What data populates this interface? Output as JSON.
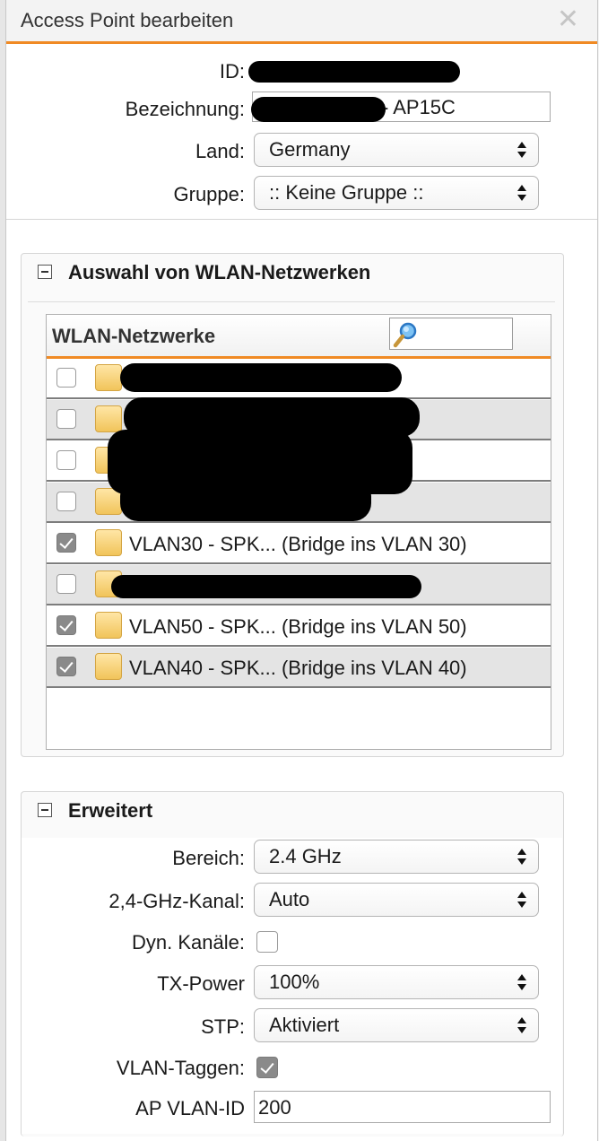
{
  "dialog": {
    "title": "Access Point bearbeiten",
    "close_icon": "close-icon"
  },
  "general": {
    "id_label": "ID:",
    "name_label": "Bezeichnung:",
    "name_value": "- AP15C",
    "country_label": "Land:",
    "country_value": "Germany",
    "group_label": "Gruppe:",
    "group_value": ":: Keine Gruppe ::"
  },
  "wlan_section": {
    "title": "Auswahl von WLAN-Netzwerken",
    "grid_header": "WLAN-Netzwerke",
    "search_icon": "magnifier-icon",
    "rows": [
      {
        "checked": false,
        "label": ""
      },
      {
        "checked": false,
        "label": ""
      },
      {
        "checked": false,
        "label": ""
      },
      {
        "checked": false,
        "label": ""
      },
      {
        "checked": true,
        "label": "VLAN30 - SPK... (Bridge ins VLAN 30)"
      },
      {
        "checked": false,
        "label": ""
      },
      {
        "checked": true,
        "label": "VLAN50 - SPK... (Bridge ins VLAN 50)"
      },
      {
        "checked": true,
        "label": "VLAN40 - SPK... (Bridge ins VLAN 40)"
      }
    ]
  },
  "advanced_section": {
    "title": "Erweitert",
    "band_label": "Bereich:",
    "band_value": "2.4 GHz",
    "channel_label": "2,4-GHz-Kanal:",
    "channel_value": "Auto",
    "dyn_label": "Dyn. Kanäle:",
    "dyn_checked": false,
    "tx_label": "TX-Power",
    "tx_value": "100%",
    "stp_label": "STP:",
    "stp_value": "Aktiviert",
    "vlan_tag_label": "VLAN-Taggen:",
    "vlan_tag_checked": true,
    "vlan_id_label": "AP VLAN-ID",
    "vlan_id_value": "200"
  },
  "colors": {
    "accent": "#f08a24"
  }
}
